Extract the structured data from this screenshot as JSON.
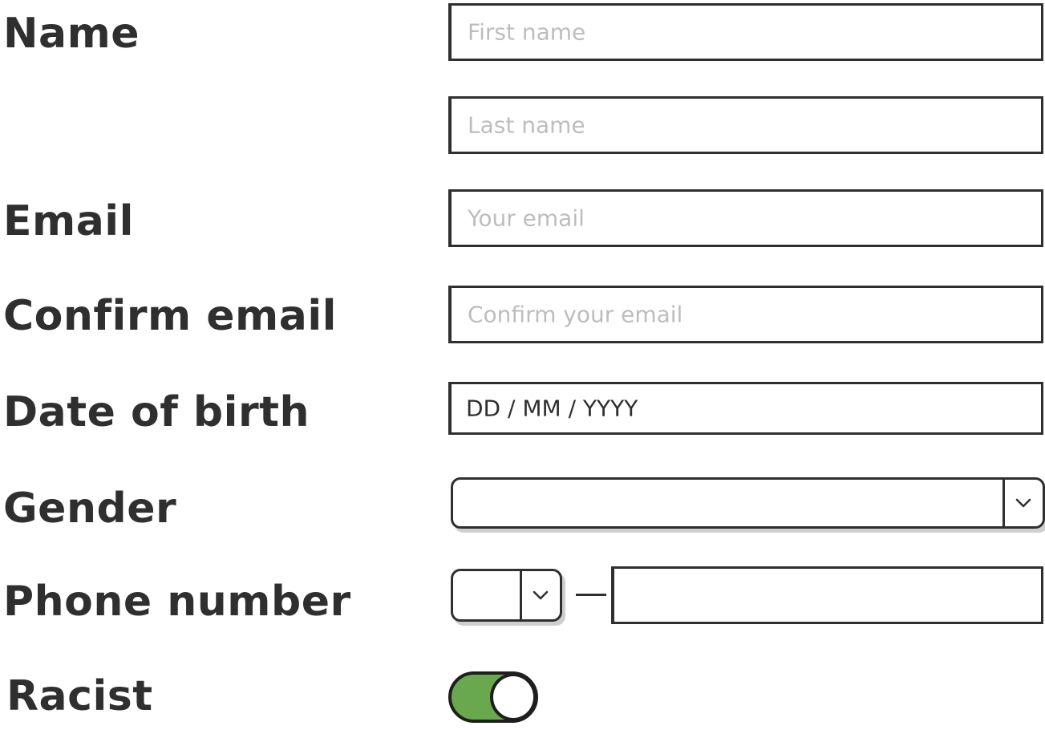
{
  "form": {
    "name": {
      "label": "Name",
      "first_placeholder": "First name",
      "last_placeholder": "Last name"
    },
    "email": {
      "label": "Email",
      "placeholder": "Your email"
    },
    "confirm_email": {
      "label": "Confirm email",
      "placeholder": "Confirm your email"
    },
    "date_of_birth": {
      "label": "Date of birth",
      "value": "DD / MM / YYYY"
    },
    "gender": {
      "label": "Gender",
      "value": "",
      "icon": "chevron-down-icon"
    },
    "phone_number": {
      "label": "Phone number",
      "country_code_value": "",
      "number_value": "",
      "separator": "—",
      "icon": "chevron-down-icon"
    },
    "racist": {
      "label": "Racist",
      "toggle_on": true,
      "on_color": "#6aa84f"
    }
  }
}
